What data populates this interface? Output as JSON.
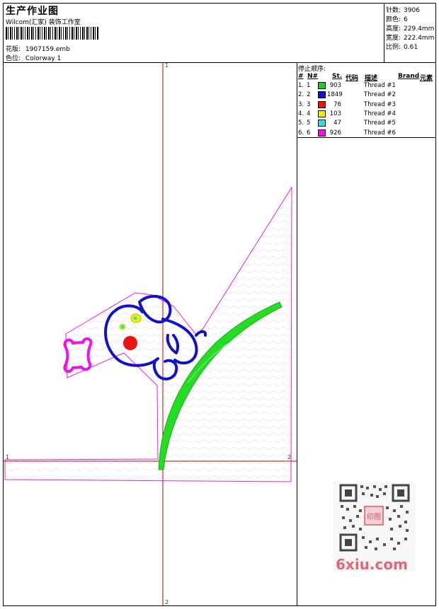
{
  "header": {
    "title": "生产作业图",
    "company": "Wilcom(汇家) 装饰工作室",
    "design_label": "花版:",
    "design_value": "1907159.emb",
    "colorway_label": "色位:",
    "colorway_value": "Colorway 1"
  },
  "stats": [
    {
      "label": "针数:",
      "value": "3906"
    },
    {
      "label": "颜色:",
      "value": "6"
    },
    {
      "label": "高度:",
      "value": "229.4mm"
    },
    {
      "label": "宽度:",
      "value": "222.4mm"
    },
    {
      "label": "比例:",
      "value": "0.61"
    }
  ],
  "thread_table": {
    "title": "停止顺序:",
    "columns": [
      "#",
      "N#",
      "St.",
      "代码",
      "描述",
      "Brand",
      "元素"
    ],
    "rows": [
      {
        "num": "1.",
        "n": "1",
        "color": "#22cc22",
        "stitches": "903",
        "desc": "Thread #1"
      },
      {
        "num": "2.",
        "n": "2",
        "color": "#1111cc",
        "stitches": "1849",
        "desc": "Thread #2"
      },
      {
        "num": "3.",
        "n": "3",
        "color": "#ee1111",
        "stitches": "76",
        "desc": "Thread #3"
      },
      {
        "num": "4.",
        "n": "4",
        "color": "#f2f200",
        "stitches": "103",
        "desc": "Thread #4"
      },
      {
        "num": "5.",
        "n": "5",
        "color": "#33dddd",
        "stitches": "47",
        "desc": "Thread #5"
      },
      {
        "num": "6.",
        "n": "6",
        "color": "#ee11ee",
        "stitches": "926",
        "desc": "Thread #6"
      }
    ]
  },
  "markers": {
    "top": "1",
    "left": "1",
    "right": "2",
    "bottom": "2"
  },
  "watermark": {
    "text": "6xiu.com",
    "seal": "印图"
  },
  "colors": {
    "frame": "#000000",
    "axis": "#cc0000",
    "outline": "#dd22dd",
    "stem": "#22dd22",
    "dog": "#1111cc",
    "nose": "#ee1111"
  }
}
